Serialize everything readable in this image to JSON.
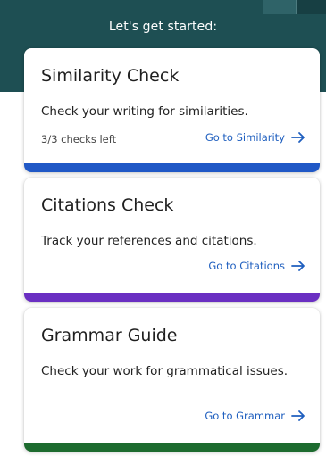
{
  "header": {
    "title": "Let's get started:"
  },
  "cards": [
    {
      "title": "Similarity Check",
      "description": "Check your writing for similarities.",
      "meta": "3/3 checks left",
      "link_label": "Go to Similarity",
      "accent_color": "#2058c6"
    },
    {
      "title": "Citations Check",
      "description": "Track your references and citations.",
      "link_label": "Go to Citations",
      "accent_color": "#6a2fc2"
    },
    {
      "title": "Grammar Guide",
      "description": "Check your work for grammatical issues.",
      "link_label": "Go to Grammar",
      "accent_color": "#1d6b2f"
    }
  ],
  "colors": {
    "header_bg": "#1e4f53",
    "link": "#1f5fbf"
  },
  "icons": {
    "link_arrow": "arrow-right-icon"
  }
}
